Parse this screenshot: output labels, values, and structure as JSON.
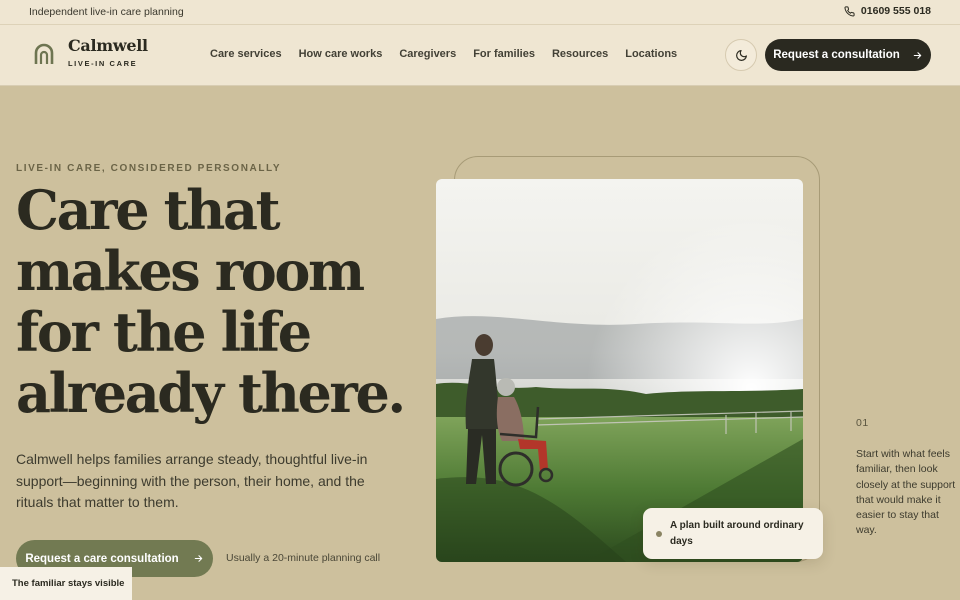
{
  "topbar": {
    "tagline": "Independent live-in care planning",
    "phone": "01609 555 018",
    "phone_icon": "phone-icon"
  },
  "brand": {
    "name": "Calmwell",
    "subtitle": "LIVE-IN CARE",
    "logo_icon": "arch-logo-icon"
  },
  "nav": {
    "items": [
      {
        "label": "Care services"
      },
      {
        "label": "How care works"
      },
      {
        "label": "Caregivers"
      },
      {
        "label": "For families"
      },
      {
        "label": "Resources"
      },
      {
        "label": "Locations"
      }
    ]
  },
  "header": {
    "theme_toggle_icon": "moon-icon",
    "cta_label": "Request a consultation",
    "cta_icon": "arrow-right-icon"
  },
  "hero": {
    "eyebrow": "LIVE-IN CARE, CONSIDERED PERSONALLY",
    "headline": "Care that makes room for the life already there.",
    "lede": "Calmwell helps families arrange steady, thoughtful live-in support—beginning with the person, their home, and the rituals that matter to them.",
    "cta_label": "Request a care consultation",
    "cta_icon": "arrow-right-icon",
    "cta_note": "Usually a 20-minute planning call"
  },
  "image_card": {
    "caption": "A plan built around ordinary days"
  },
  "step": {
    "number": "01",
    "text": "Start with what feels familiar, then look closely at the support that would make it easier to stay that way."
  },
  "sticky_label": "The familiar stays visible",
  "colors": {
    "page_bg": "#cdc09d",
    "header_bg": "#efe6d2",
    "dark": "#2a2920",
    "olive": "#727a52"
  }
}
